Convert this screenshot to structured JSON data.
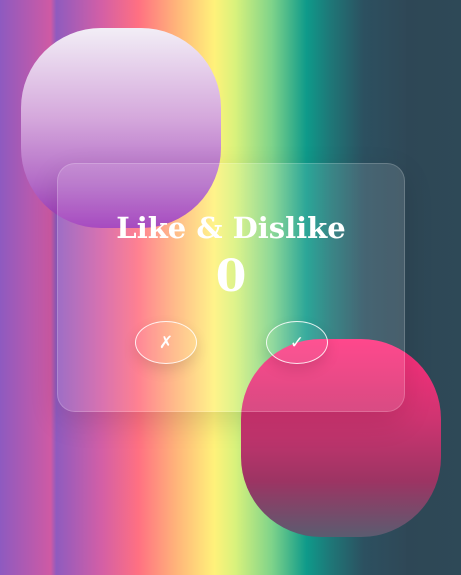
{
  "app": {
    "title": "Like & Dislike",
    "count": "0"
  },
  "buttons": {
    "dislike": {
      "label": "✗",
      "icon": "cross-icon"
    },
    "like": {
      "label": "✓",
      "icon": "check-icon"
    }
  },
  "colors": {
    "text": "#ffffff",
    "blob_purple": "#9b32b8",
    "blob_pink": "#ff2f7d"
  }
}
